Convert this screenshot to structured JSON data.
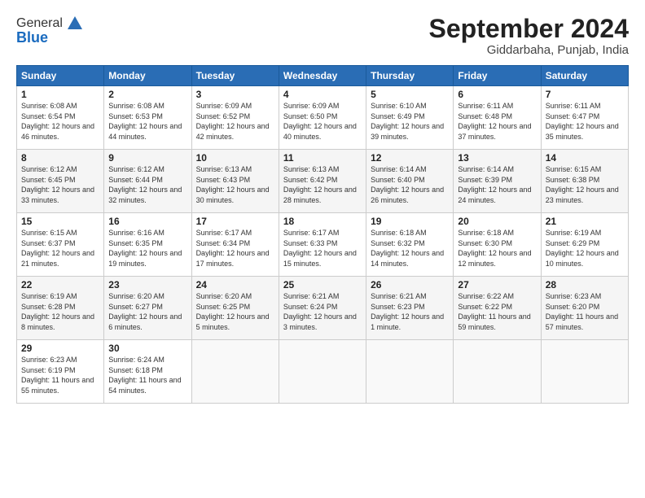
{
  "header": {
    "logo_general": "General",
    "logo_blue": "Blue",
    "month": "September 2024",
    "location": "Giddarbaha, Punjab, India"
  },
  "weekdays": [
    "Sunday",
    "Monday",
    "Tuesday",
    "Wednesday",
    "Thursday",
    "Friday",
    "Saturday"
  ],
  "weeks": [
    [
      {
        "day": "1",
        "sunrise": "6:08 AM",
        "sunset": "6:54 PM",
        "daylight": "12 hours and 46 minutes."
      },
      {
        "day": "2",
        "sunrise": "6:08 AM",
        "sunset": "6:53 PM",
        "daylight": "12 hours and 44 minutes."
      },
      {
        "day": "3",
        "sunrise": "6:09 AM",
        "sunset": "6:52 PM",
        "daylight": "12 hours and 42 minutes."
      },
      {
        "day": "4",
        "sunrise": "6:09 AM",
        "sunset": "6:50 PM",
        "daylight": "12 hours and 40 minutes."
      },
      {
        "day": "5",
        "sunrise": "6:10 AM",
        "sunset": "6:49 PM",
        "daylight": "12 hours and 39 minutes."
      },
      {
        "day": "6",
        "sunrise": "6:11 AM",
        "sunset": "6:48 PM",
        "daylight": "12 hours and 37 minutes."
      },
      {
        "day": "7",
        "sunrise": "6:11 AM",
        "sunset": "6:47 PM",
        "daylight": "12 hours and 35 minutes."
      }
    ],
    [
      {
        "day": "8",
        "sunrise": "6:12 AM",
        "sunset": "6:45 PM",
        "daylight": "12 hours and 33 minutes."
      },
      {
        "day": "9",
        "sunrise": "6:12 AM",
        "sunset": "6:44 PM",
        "daylight": "12 hours and 32 minutes."
      },
      {
        "day": "10",
        "sunrise": "6:13 AM",
        "sunset": "6:43 PM",
        "daylight": "12 hours and 30 minutes."
      },
      {
        "day": "11",
        "sunrise": "6:13 AM",
        "sunset": "6:42 PM",
        "daylight": "12 hours and 28 minutes."
      },
      {
        "day": "12",
        "sunrise": "6:14 AM",
        "sunset": "6:40 PM",
        "daylight": "12 hours and 26 minutes."
      },
      {
        "day": "13",
        "sunrise": "6:14 AM",
        "sunset": "6:39 PM",
        "daylight": "12 hours and 24 minutes."
      },
      {
        "day": "14",
        "sunrise": "6:15 AM",
        "sunset": "6:38 PM",
        "daylight": "12 hours and 23 minutes."
      }
    ],
    [
      {
        "day": "15",
        "sunrise": "6:15 AM",
        "sunset": "6:37 PM",
        "daylight": "12 hours and 21 minutes."
      },
      {
        "day": "16",
        "sunrise": "6:16 AM",
        "sunset": "6:35 PM",
        "daylight": "12 hours and 19 minutes."
      },
      {
        "day": "17",
        "sunrise": "6:17 AM",
        "sunset": "6:34 PM",
        "daylight": "12 hours and 17 minutes."
      },
      {
        "day": "18",
        "sunrise": "6:17 AM",
        "sunset": "6:33 PM",
        "daylight": "12 hours and 15 minutes."
      },
      {
        "day": "19",
        "sunrise": "6:18 AM",
        "sunset": "6:32 PM",
        "daylight": "12 hours and 14 minutes."
      },
      {
        "day": "20",
        "sunrise": "6:18 AM",
        "sunset": "6:30 PM",
        "daylight": "12 hours and 12 minutes."
      },
      {
        "day": "21",
        "sunrise": "6:19 AM",
        "sunset": "6:29 PM",
        "daylight": "12 hours and 10 minutes."
      }
    ],
    [
      {
        "day": "22",
        "sunrise": "6:19 AM",
        "sunset": "6:28 PM",
        "daylight": "12 hours and 8 minutes."
      },
      {
        "day": "23",
        "sunrise": "6:20 AM",
        "sunset": "6:27 PM",
        "daylight": "12 hours and 6 minutes."
      },
      {
        "day": "24",
        "sunrise": "6:20 AM",
        "sunset": "6:25 PM",
        "daylight": "12 hours and 5 minutes."
      },
      {
        "day": "25",
        "sunrise": "6:21 AM",
        "sunset": "6:24 PM",
        "daylight": "12 hours and 3 minutes."
      },
      {
        "day": "26",
        "sunrise": "6:21 AM",
        "sunset": "6:23 PM",
        "daylight": "12 hours and 1 minute."
      },
      {
        "day": "27",
        "sunrise": "6:22 AM",
        "sunset": "6:22 PM",
        "daylight": "11 hours and 59 minutes."
      },
      {
        "day": "28",
        "sunrise": "6:23 AM",
        "sunset": "6:20 PM",
        "daylight": "11 hours and 57 minutes."
      }
    ],
    [
      {
        "day": "29",
        "sunrise": "6:23 AM",
        "sunset": "6:19 PM",
        "daylight": "11 hours and 55 minutes."
      },
      {
        "day": "30",
        "sunrise": "6:24 AM",
        "sunset": "6:18 PM",
        "daylight": "11 hours and 54 minutes."
      },
      null,
      null,
      null,
      null,
      null
    ]
  ]
}
